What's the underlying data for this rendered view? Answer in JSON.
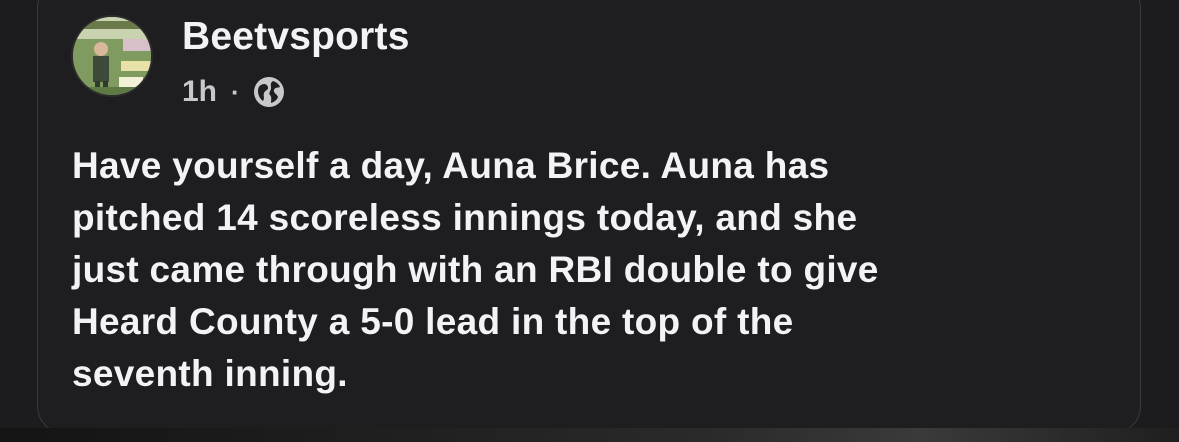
{
  "post": {
    "author": "Beetvsports",
    "time": "1h",
    "separator": "·",
    "audience_icon": "globe-icon",
    "text": "Have yourself a day, Auna Brice. Auna has\npitched 14 scoreless innings today, and she\njust came through with an  RBI double to give\nHeard County a 5-0 lead in the top of the\nseventh inning."
  },
  "colors": {
    "background": "#1c1c1e",
    "card_border": "#3a3a3c",
    "text_primary": "#f2f2f7",
    "text_secondary": "#c7c7cc"
  }
}
